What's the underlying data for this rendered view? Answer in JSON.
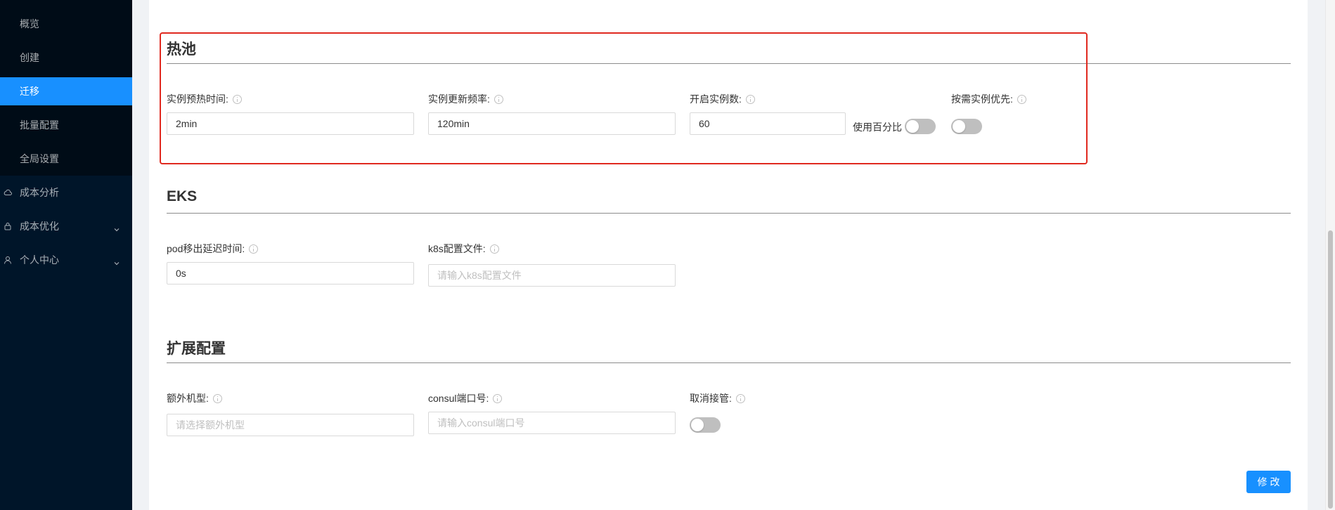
{
  "sidebar": {
    "sub_items": [
      {
        "label": "概览"
      },
      {
        "label": "创建"
      },
      {
        "label": "迁移"
      },
      {
        "label": "批量配置"
      },
      {
        "label": "全局设置"
      }
    ],
    "top_items": [
      {
        "label": "成本分析",
        "icon": "cloud-icon"
      },
      {
        "label": "成本优化",
        "icon": "lock-icon"
      },
      {
        "label": "个人中心",
        "icon": "user-icon"
      }
    ]
  },
  "sections": {
    "hot_pool": {
      "title": "热池",
      "warmup_label": "实例预热时间:",
      "warmup_value": "2min",
      "update_label": "实例更新频率:",
      "update_value": "120min",
      "count_label": "开启实例数:",
      "count_value": "60",
      "percent_label": "使用百分比",
      "ondemand_label": "按需实例优先:"
    },
    "eks": {
      "title": "EKS",
      "pod_delay_label": "pod移出延迟时间:",
      "pod_delay_value": "0s",
      "k8s_label": "k8s配置文件:",
      "k8s_placeholder": "请输入k8s配置文件"
    },
    "ext": {
      "title": "扩展配置",
      "extra_type_label": "额外机型:",
      "extra_type_placeholder": "请选择额外机型",
      "consul_label": "consul端口号:",
      "consul_placeholder": "请输入consul端口号",
      "cancel_label": "取消接管:"
    }
  },
  "actions": {
    "modify_label": "修改"
  },
  "colors": {
    "accent": "#1890ff",
    "sidebar_bg": "#001529",
    "highlight_border": "#e0291f"
  }
}
